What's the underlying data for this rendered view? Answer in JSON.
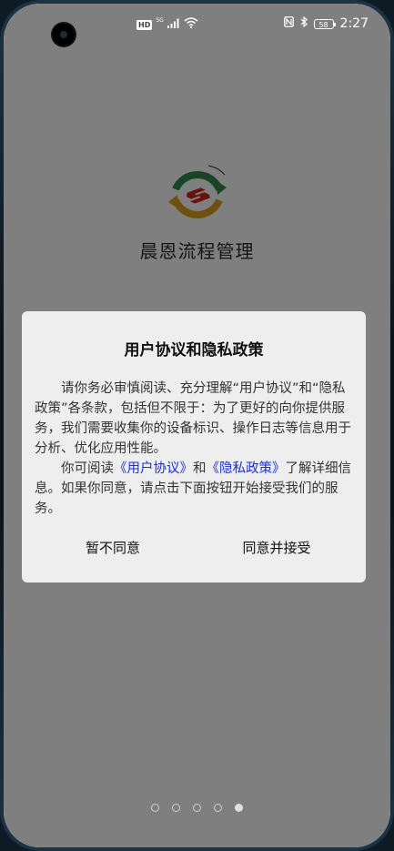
{
  "status_bar": {
    "hd": "HD",
    "network": "5G",
    "battery": "58",
    "time": "2:27",
    "icons": [
      "signal-icon",
      "wifi-icon",
      "nfc-icon",
      "bluetooth-icon",
      "battery-icon"
    ]
  },
  "app": {
    "name": "晨恩流程管理"
  },
  "dialog": {
    "title": "用户协议和隐私政策",
    "paragraph1": "请你务必审慎阅读、充分理解“用户协议”和“隐私政策”各条款，包括但不限于：为了更好的向你提供服务，我们需要收集你的设备标识、操作日志等信息用于分析、优化应用性能。",
    "p2_prefix": "你可阅读",
    "link_user_agreement": "《用户协议》",
    "p2_and": "和",
    "link_privacy_policy": "《隐私政策》",
    "p2_suffix": "了解详细信息。如果你同意，请点击下面按钮开始接受我们的服务。",
    "disagree_label": "暂不同意",
    "agree_label": "同意并接受"
  },
  "pager": {
    "count": 5,
    "active_index": 4
  },
  "colors": {
    "link": "#1a2fd6",
    "overlay": "rgba(0,0,0,0.5)",
    "dialog_bg": "#eeeeee",
    "logo_green": "#2f8a4a",
    "logo_orange": "#e0a020",
    "logo_red": "#d0281c"
  }
}
